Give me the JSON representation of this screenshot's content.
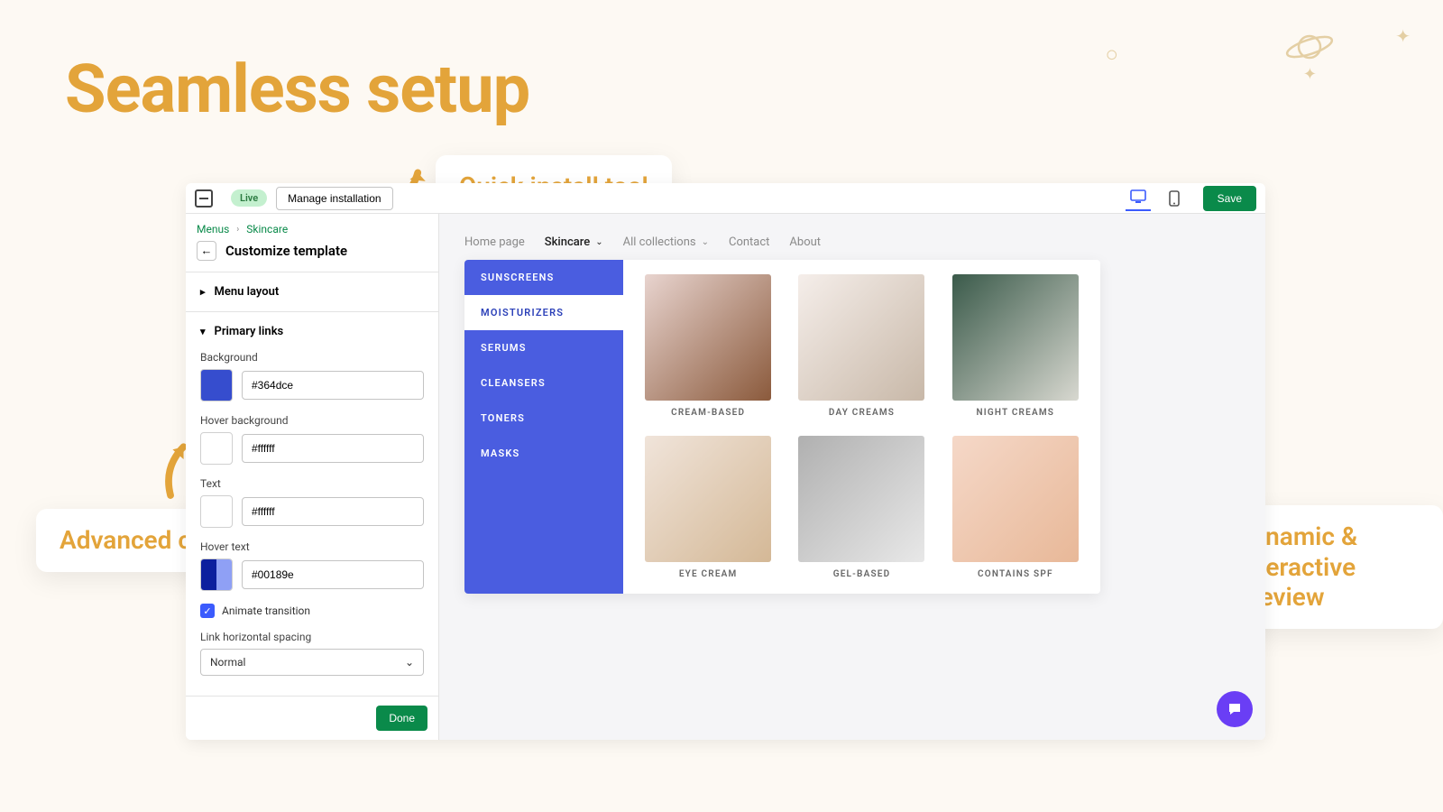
{
  "hero_title": "Seamless setup",
  "callouts": {
    "quick": "Quick install tool",
    "advanced": "Advanced customization options",
    "dynamic": "Dynamic & interactive preview"
  },
  "topbar": {
    "live_badge": "Live",
    "manage_installation": "Manage installation",
    "save": "Save"
  },
  "breadcrumb": {
    "root": "Menus",
    "current": "Skincare"
  },
  "sidebar": {
    "back_aria": "Back",
    "customize_title": "Customize template",
    "sections": {
      "menu_layout": "Menu layout",
      "primary_links": "Primary links"
    },
    "fields": {
      "background_label": "Background",
      "background_value": "#364dce",
      "hover_bg_label": "Hover background",
      "hover_bg_value": "#ffffff",
      "text_label": "Text",
      "text_value": "#ffffff",
      "hover_text_label": "Hover text",
      "hover_text_value": "#00189e",
      "animate_label": "Animate transition",
      "animate_checked": true,
      "spacing_label": "Link horizontal spacing",
      "spacing_value": "Normal"
    },
    "done": "Done"
  },
  "preview_nav": [
    {
      "label": "Home page",
      "active": false,
      "dropdown": false
    },
    {
      "label": "Skincare",
      "active": true,
      "dropdown": true
    },
    {
      "label": "All collections",
      "active": false,
      "dropdown": true
    },
    {
      "label": "Contact",
      "active": false,
      "dropdown": false
    },
    {
      "label": "About",
      "active": false,
      "dropdown": false
    }
  ],
  "mega_menu": {
    "links": [
      {
        "label": "SUNSCREENS",
        "active": false
      },
      {
        "label": "MOISTURIZERS",
        "active": true
      },
      {
        "label": "SERUMS",
        "active": false
      },
      {
        "label": "CLEANSERS",
        "active": false
      },
      {
        "label": "TONERS",
        "active": false
      },
      {
        "label": "MASKS",
        "active": false
      }
    ],
    "products": [
      "CREAM-BASED",
      "DAY CREAMS",
      "NIGHT CREAMS",
      "EYE CREAM",
      "GEL-BASED",
      "CONTAINS SPF"
    ]
  },
  "icons": {
    "desktop": "desktop-icon",
    "mobile": "mobile-icon",
    "chat": "chat-icon"
  }
}
